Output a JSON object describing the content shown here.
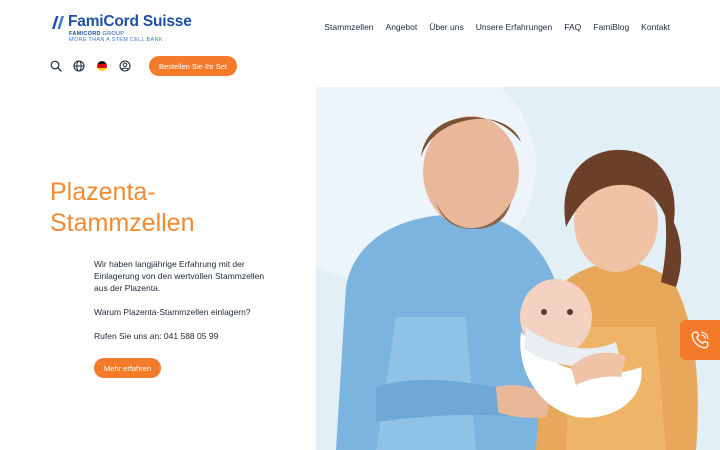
{
  "header": {
    "brand": "FamiCord Suisse",
    "group_bold": "FAMICORD",
    "group_thin": " GROUP",
    "tagline": "MORE THAN A STEM CELL BANK",
    "nav": [
      "Stammzellen",
      "Angebot",
      "Über uns",
      "Unsere Erfahrungen",
      "FAQ",
      "FamiBlog",
      "Kontakt"
    ],
    "order_button": "Bestellen Sie Ihr Set"
  },
  "hero": {
    "title_line1": "Plazenta-",
    "title_line2": "Stammzellen",
    "paragraph": "Wir haben langjährige Erfahrung mit der Einlagerung von den wertvollen Stammzellen aus der Plazenta.",
    "question": "Warum Plazenta-Stammzellen einlagern?",
    "phone_line": "Rufen Sie uns an: 041 588 05 99",
    "more_button": "Mehr erfahren"
  },
  "icons": {
    "search": "search-icon",
    "language": "globe-icon",
    "flag": "german-flag-icon",
    "account": "user-icon",
    "call": "phone-icon"
  },
  "colors": {
    "accent": "#f47b2a",
    "brand_blue": "#1e4fa3",
    "title_orange": "#f08a33"
  }
}
